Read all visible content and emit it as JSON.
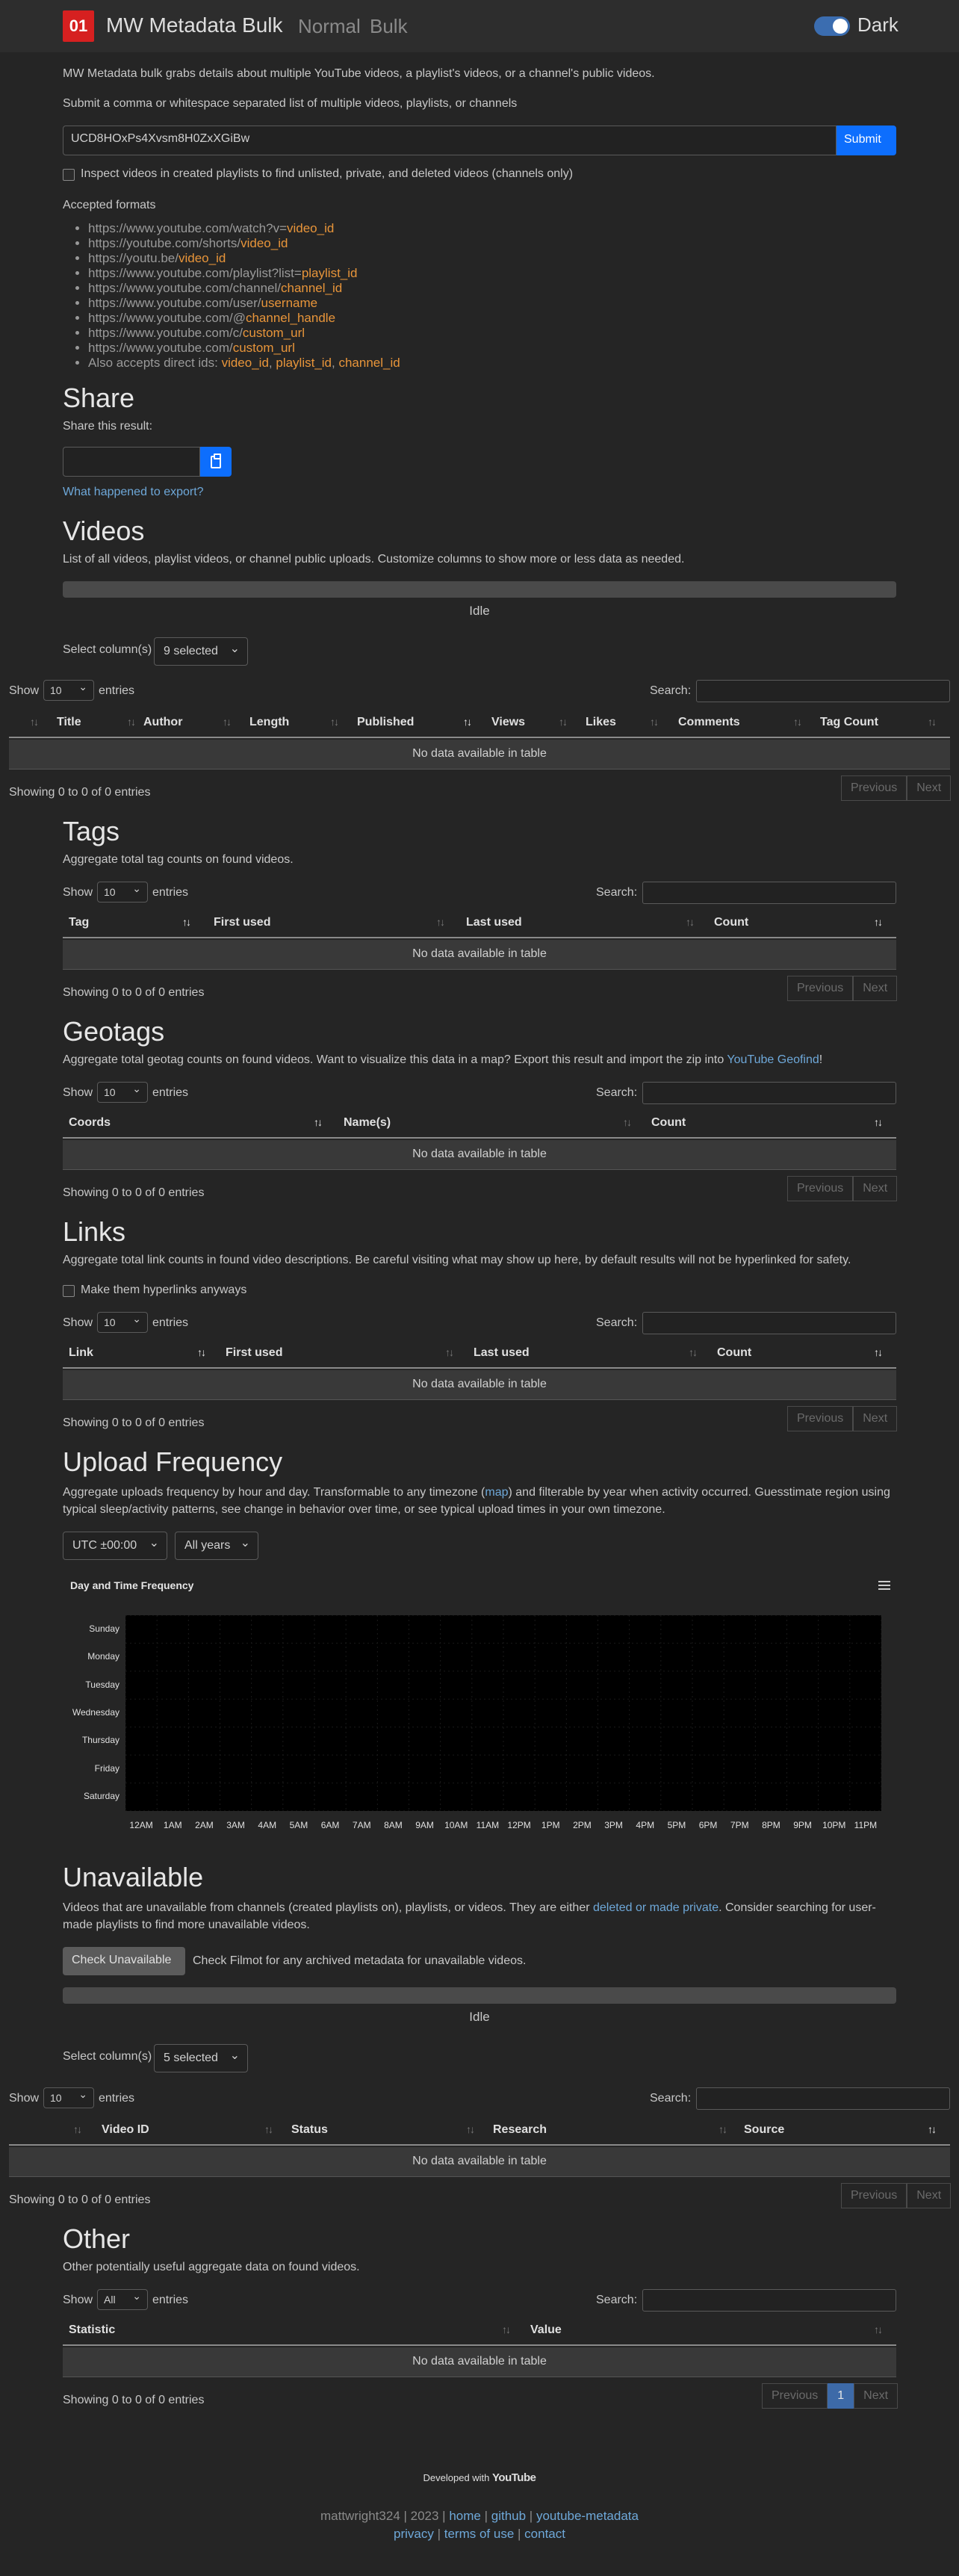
{
  "nav": {
    "logo": "01",
    "brand": "MW Metadata Bulk",
    "links": [
      "Normal",
      "Bulk"
    ],
    "theme_label": "Dark"
  },
  "intro": {
    "description": "MW Metadata bulk grabs details about multiple YouTube videos, a playlist's videos, or a channel's public videos.",
    "submit_prompt": "Submit a comma or whitespace separated list of multiple videos, playlists, or channels",
    "input_value": "UCD8HOxPs4Xvsm8H0ZxXGiBw",
    "submit_label": "Submit",
    "inspect_label": "Inspect videos in created playlists to find unlisted, private, and deleted videos (channels only)"
  },
  "formats": {
    "title": "Accepted formats",
    "items": [
      {
        "prefix": "https://www.youtube.com/watch?v=",
        "param": "video_id"
      },
      {
        "prefix": "https://youtube.com/shorts/",
        "param": "video_id"
      },
      {
        "prefix": "https://youtu.be/",
        "param": "video_id"
      },
      {
        "prefix": "https://www.youtube.com/playlist?list=",
        "param": "playlist_id"
      },
      {
        "prefix": "https://www.youtube.com/channel/",
        "param": "channel_id"
      },
      {
        "prefix": "https://www.youtube.com/user/",
        "param": "username"
      },
      {
        "prefix": "https://www.youtube.com/@",
        "param": "channel_handle"
      },
      {
        "prefix": "https://www.youtube.com/c/",
        "param": "custom_url"
      },
      {
        "prefix": "https://www.youtube.com/",
        "param": "custom_url"
      }
    ],
    "direct_prefix": "Also accepts direct ids: ",
    "direct_ids": [
      "video_id",
      "playlist_id",
      "channel_id"
    ]
  },
  "share": {
    "title": "Share",
    "subtitle": "Share this result:",
    "export_link": "What happened to export?"
  },
  "videos": {
    "title": "Videos",
    "description": "List of all videos, playlist videos, or channel public uploads. Customize columns to show more or less data as needed.",
    "status": "Idle",
    "select_label": "Select column(s)",
    "select_value": "9 selected",
    "show": "Show",
    "entries_value": "10",
    "entries": "entries",
    "search": "Search:",
    "columns": [
      "Title",
      "Author",
      "Length",
      "Published",
      "Views",
      "Likes",
      "Comments",
      "Tag Count"
    ],
    "empty": "No data available in table",
    "info": "Showing 0 to 0 of 0 entries",
    "prev": "Previous",
    "next": "Next"
  },
  "tags": {
    "title": "Tags",
    "description": "Aggregate total tag counts on found videos.",
    "columns": [
      "Tag",
      "First used",
      "Last used",
      "Count"
    ],
    "entries_value": "10"
  },
  "geotags": {
    "title": "Geotags",
    "description": "Aggregate total geotag counts on found videos. Want to visualize this data in a map? Export this result and import the zip into ",
    "link": "YouTube Geofind",
    "end": "!",
    "columns": [
      "Coords",
      "Name(s)",
      "Count"
    ],
    "entries_value": "10"
  },
  "links": {
    "title": "Links",
    "description": "Aggregate total link counts in found video descriptions. Be careful visiting what may show up here, by default results will not be hyperlinked for safety.",
    "checkbox": "Make them hyperlinks anyways",
    "columns": [
      "Link",
      "First used",
      "Last used",
      "Count"
    ],
    "entries_value": "10"
  },
  "upload": {
    "title": "Upload Frequency",
    "description_a": "Aggregate uploads frequency by hour and day. Transformable to any timezone (",
    "map_link": "map",
    "description_b": ") and filterable by year when activity occurred. Guesstimate region using typical sleep/activity patterns, see change in behavior over time, or see typical upload times in your own timezone.",
    "timezone": "UTC ±00:00",
    "years": "All years"
  },
  "chart_data": {
    "type": "heatmap",
    "title": "Day and Time Frequency",
    "y_categories": [
      "Sunday",
      "Monday",
      "Tuesday",
      "Wednesday",
      "Thursday",
      "Friday",
      "Saturday"
    ],
    "x_categories": [
      "12AM",
      "1AM",
      "2AM",
      "3AM",
      "4AM",
      "5AM",
      "6AM",
      "7AM",
      "8AM",
      "9AM",
      "10AM",
      "11AM",
      "12PM",
      "1PM",
      "2PM",
      "3PM",
      "4PM",
      "5PM",
      "6PM",
      "7PM",
      "8PM",
      "9PM",
      "10PM",
      "11PM"
    ],
    "values": [],
    "background": "#000000"
  },
  "unavailable": {
    "title": "Unavailable",
    "description_a": "Videos that are unavailable from channels (created playlists on), playlists, or videos. They are either ",
    "link": "deleted or made private",
    "description_b": ". Consider searching for user-made playlists to find more unavailable videos.",
    "check_button": "Check Unavailable",
    "check_note": "Check Filmot for any archived metadata for unavailable videos.",
    "status": "Idle",
    "select_value": "5 selected",
    "columns": [
      "Video ID",
      "Status",
      "Research",
      "Source"
    ],
    "entries_value": "10"
  },
  "other": {
    "title": "Other",
    "description": "Other potentially useful aggregate data on found videos.",
    "entries_value": "All",
    "columns": [
      "Statistic",
      "Value"
    ],
    "page": "1"
  },
  "footer": {
    "developed": "Developed with",
    "youtube": "YouTube",
    "author": "mattwright324 | 2023 |",
    "home": "home",
    "github": "github",
    "repo": "youtube-metadata",
    "privacy": "privacy",
    "terms": "terms of use",
    "contact": "contact"
  },
  "colors": {
    "accent": "#0d6efd",
    "logo": "#d62020",
    "param": "#e8953a",
    "link": "#6ea8d9"
  }
}
